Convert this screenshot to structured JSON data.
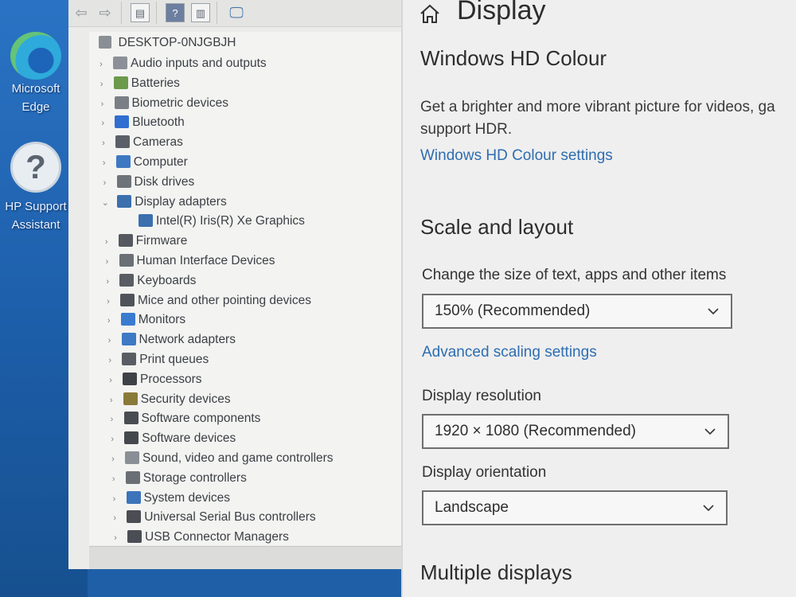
{
  "desktop": {
    "icons": [
      {
        "name": "edge",
        "label_lines": [
          "Microsoft",
          "Edge"
        ]
      },
      {
        "name": "hp-support",
        "label_lines": [
          "HP Support",
          "Assistant"
        ]
      }
    ]
  },
  "device_manager": {
    "toolbar_icons": [
      "back-arrow-icon",
      "forward-arrow-icon",
      "properties-icon",
      "help-icon",
      "show-hidden-icon",
      "monitor-scan-icon"
    ],
    "root": "DESKTOP-0NJGBJH",
    "categories": [
      {
        "label": "Audio inputs and outputs",
        "icon": "speaker-icon",
        "expanded": false
      },
      {
        "label": "Batteries",
        "icon": "battery-icon",
        "expanded": false
      },
      {
        "label": "Biometric devices",
        "icon": "biometric-icon",
        "expanded": false
      },
      {
        "label": "Bluetooth",
        "icon": "bluetooth-icon",
        "expanded": false
      },
      {
        "label": "Cameras",
        "icon": "camera-icon",
        "expanded": false
      },
      {
        "label": "Computer",
        "icon": "computer-icon",
        "expanded": false
      },
      {
        "label": "Disk drives",
        "icon": "disk-icon",
        "expanded": false
      },
      {
        "label": "Display adapters",
        "icon": "display-adapter-icon",
        "expanded": true
      },
      {
        "label": "Intel(R) Iris(R) Xe Graphics",
        "icon": "display-adapter-icon",
        "child": true
      },
      {
        "label": "Firmware",
        "icon": "firmware-icon",
        "expanded": false
      },
      {
        "label": "Human Interface Devices",
        "icon": "hid-icon",
        "expanded": false
      },
      {
        "label": "Keyboards",
        "icon": "keyboard-icon",
        "expanded": false
      },
      {
        "label": "Mice and other pointing devices",
        "icon": "mouse-icon",
        "expanded": false
      },
      {
        "label": "Monitors",
        "icon": "monitor-icon",
        "expanded": false
      },
      {
        "label": "Network adapters",
        "icon": "network-icon",
        "expanded": false
      },
      {
        "label": "Print queues",
        "icon": "printer-icon",
        "expanded": false
      },
      {
        "label": "Processors",
        "icon": "processor-icon",
        "expanded": false
      },
      {
        "label": "Security devices",
        "icon": "security-icon",
        "expanded": false
      },
      {
        "label": "Software components",
        "icon": "software-component-icon",
        "expanded": false
      },
      {
        "label": "Software devices",
        "icon": "software-device-icon",
        "expanded": false
      },
      {
        "label": "Sound, video and game controllers",
        "icon": "sound-icon",
        "expanded": false
      },
      {
        "label": "Storage controllers",
        "icon": "storage-icon",
        "expanded": false
      },
      {
        "label": "System devices",
        "icon": "system-icon",
        "expanded": false
      },
      {
        "label": "Universal Serial Bus controllers",
        "icon": "usb-icon",
        "expanded": false
      },
      {
        "label": "USB Connector Managers",
        "icon": "usb-icon",
        "expanded": false
      }
    ]
  },
  "settings": {
    "page_title": "Display",
    "hdr": {
      "title": "Windows HD Colour",
      "description_lines": [
        "Get a brighter and more vibrant picture for videos, ga",
        "support HDR."
      ],
      "link": "Windows HD Colour settings"
    },
    "scale": {
      "title": "Scale and layout",
      "size_label": "Change the size of text, apps and other items",
      "size_value": "150% (Recommended)",
      "advanced_link": "Advanced scaling settings",
      "resolution_label": "Display resolution",
      "resolution_value": "1920 × 1080 (Recommended)",
      "orientation_label": "Display orientation",
      "orientation_value": "Landscape"
    },
    "multiple": {
      "title": "Multiple displays"
    }
  }
}
